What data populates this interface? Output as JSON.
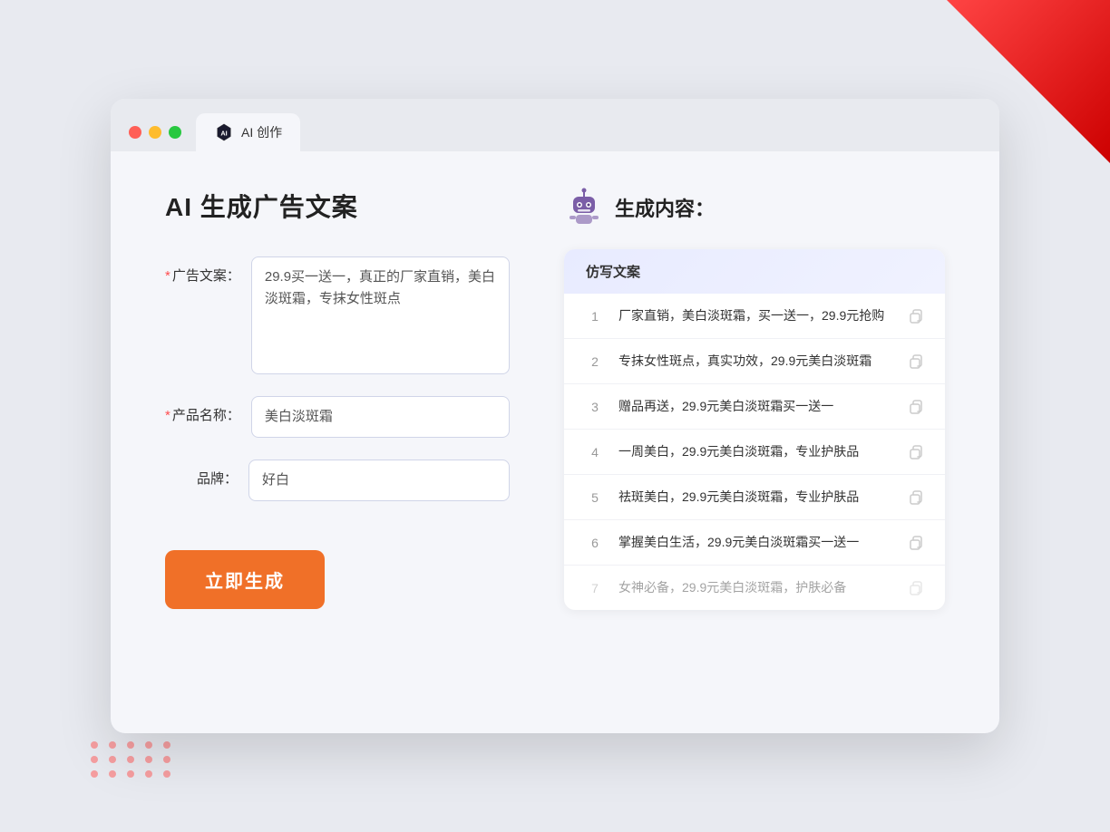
{
  "window": {
    "tab_title": "AI 创作",
    "controls": {
      "close": "close",
      "minimize": "minimize",
      "maximize": "maximize"
    }
  },
  "left_panel": {
    "page_title": "AI 生成广告文案",
    "form": {
      "ad_copy_label": "广告文案：",
      "ad_copy_required": "*",
      "ad_copy_value": "29.9买一送一，真正的厂家直销，美白淡斑霜，专抹女性斑点",
      "product_name_label": "产品名称：",
      "product_name_required": "*",
      "product_name_value": "美白淡斑霜",
      "brand_label": "品牌：",
      "brand_value": "好白"
    },
    "generate_button": "立即生成"
  },
  "right_panel": {
    "header_title": "生成内容：",
    "results_header": "仿写文案",
    "results": [
      {
        "num": "1",
        "text": "厂家直销，美白淡斑霜，买一送一，29.9元抢购",
        "dimmed": false
      },
      {
        "num": "2",
        "text": "专抹女性斑点，真实功效，29.9元美白淡斑霜",
        "dimmed": false
      },
      {
        "num": "3",
        "text": "赠品再送，29.9元美白淡斑霜买一送一",
        "dimmed": false
      },
      {
        "num": "4",
        "text": "一周美白，29.9元美白淡斑霜，专业护肤品",
        "dimmed": false
      },
      {
        "num": "5",
        "text": "祛斑美白，29.9元美白淡斑霜，专业护肤品",
        "dimmed": false
      },
      {
        "num": "6",
        "text": "掌握美白生活，29.9元美白淡斑霜买一送一",
        "dimmed": false
      },
      {
        "num": "7",
        "text": "女神必备，29.9元美白淡斑霜，护肤必备",
        "dimmed": true
      }
    ]
  }
}
